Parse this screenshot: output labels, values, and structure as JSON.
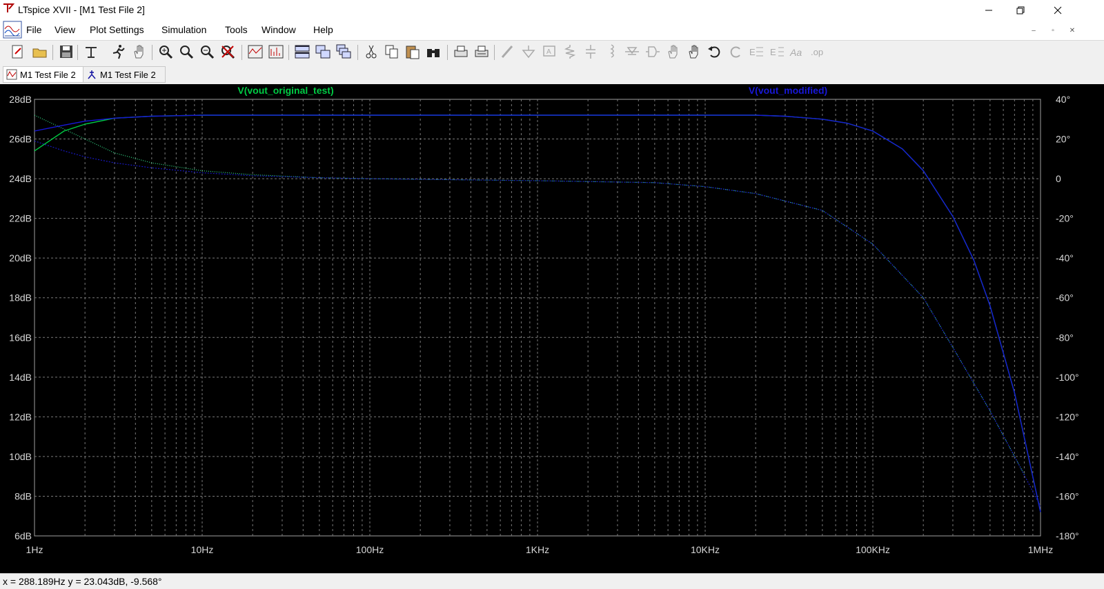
{
  "window": {
    "title": "LTspice XVII - [M1 Test File 2]"
  },
  "menu": {
    "items": [
      "File",
      "View",
      "Plot Settings",
      "Simulation",
      "Tools",
      "Window",
      "Help"
    ]
  },
  "toolbar": {
    "icons": [
      "new-schematic",
      "open",
      "save",
      "control-panel",
      "run",
      "halt",
      "zoom-area",
      "zoom-in",
      "zoom-out",
      "zoom-cancel",
      "autorange",
      "fft",
      "tile-horizontal",
      "tile-vertical",
      "cascade",
      "cut",
      "copy",
      "paste",
      "find",
      "print",
      "print-setup",
      "draw-wire",
      "ground",
      "label-net",
      "resistor",
      "capacitor",
      "inductor",
      "diode",
      "component",
      "move",
      "drag",
      "undo",
      "redo",
      "rotate",
      "mirror",
      "text",
      "spice-directive"
    ]
  },
  "tabs": [
    {
      "label": "M1 Test File 2",
      "active": true,
      "kind": "waveform"
    },
    {
      "label": "M1 Test File 2",
      "active": false,
      "kind": "schematic"
    }
  ],
  "status": {
    "text": "x = 288.189Hz   y = 23.043dB, -9.568°"
  },
  "chart_data": {
    "type": "line",
    "x_scale": "log",
    "xlim": [
      1,
      1000000
    ],
    "x_ticks": [
      "1Hz",
      "10Hz",
      "100Hz",
      "1KHz",
      "10KHz",
      "100KHz",
      "1MHz"
    ],
    "y_left_ticks": [
      "28dB",
      "26dB",
      "24dB",
      "22dB",
      "20dB",
      "18dB",
      "16dB",
      "14dB",
      "12dB",
      "10dB",
      "8dB",
      "6dB"
    ],
    "ylim_left": [
      6,
      28
    ],
    "y_right_ticks": [
      "40°",
      "20°",
      "0",
      "-20°",
      "-40°",
      "-60°",
      "-80°",
      "-100°",
      "-120°",
      "-140°",
      "-160°",
      "-180°"
    ],
    "ylim_right": [
      -180,
      40
    ],
    "grid": true,
    "series": [
      {
        "name": "V(vout_original_test)",
        "color": "#00cc44",
        "phase_color": "#33dd88",
        "mag": [
          [
            1,
            25.4
          ],
          [
            1.5,
            26.4
          ],
          [
            2,
            26.75
          ],
          [
            3,
            27.05
          ],
          [
            5,
            27.15
          ],
          [
            10,
            27.2
          ],
          [
            100,
            27.2
          ],
          [
            1000,
            27.2
          ],
          [
            10000,
            27.2
          ],
          [
            20000,
            27.2
          ],
          [
            30000,
            27.15
          ],
          [
            50000,
            27.0
          ],
          [
            70000,
            26.8
          ],
          [
            100000,
            26.4
          ],
          [
            150000,
            25.5
          ],
          [
            200000,
            24.4
          ],
          [
            300000,
            22.1
          ],
          [
            400000,
            19.9
          ],
          [
            500000,
            17.6
          ],
          [
            700000,
            13.2
          ],
          [
            1000000,
            7.2
          ]
        ],
        "phase": [
          [
            1,
            32
          ],
          [
            1.5,
            25
          ],
          [
            2,
            20
          ],
          [
            3,
            13
          ],
          [
            5,
            8
          ],
          [
            10,
            4
          ],
          [
            20,
            2
          ],
          [
            50,
            0.5
          ],
          [
            100,
            0
          ],
          [
            300,
            -0.5
          ],
          [
            1000,
            -1
          ],
          [
            5000,
            -2
          ],
          [
            10000,
            -4
          ],
          [
            20000,
            -7.5
          ],
          [
            50000,
            -16
          ],
          [
            100000,
            -33
          ],
          [
            200000,
            -60
          ],
          [
            300000,
            -85
          ],
          [
            500000,
            -117
          ],
          [
            700000,
            -140
          ],
          [
            800000,
            -149
          ]
        ]
      },
      {
        "name": "V(vout_modified)",
        "color": "#1818d8",
        "phase_color": "#1818c0",
        "mag": [
          [
            1,
            26.4
          ],
          [
            1.5,
            26.7
          ],
          [
            2,
            26.9
          ],
          [
            3,
            27.05
          ],
          [
            5,
            27.15
          ],
          [
            10,
            27.2
          ],
          [
            100,
            27.2
          ],
          [
            1000,
            27.2
          ],
          [
            10000,
            27.2
          ],
          [
            20000,
            27.2
          ],
          [
            30000,
            27.15
          ],
          [
            50000,
            27.0
          ],
          [
            70000,
            26.8
          ],
          [
            100000,
            26.4
          ],
          [
            150000,
            25.5
          ],
          [
            200000,
            24.4
          ],
          [
            300000,
            22.1
          ],
          [
            400000,
            19.9
          ],
          [
            500000,
            17.6
          ],
          [
            700000,
            13.2
          ],
          [
            1000000,
            7.2
          ]
        ],
        "phase": [
          [
            1,
            19
          ],
          [
            1.5,
            14
          ],
          [
            2,
            11
          ],
          [
            3,
            8
          ],
          [
            5,
            5.5
          ],
          [
            10,
            3
          ],
          [
            20,
            1.5
          ],
          [
            50,
            0.5
          ],
          [
            100,
            0
          ],
          [
            300,
            -0.5
          ],
          [
            1000,
            -1
          ],
          [
            5000,
            -2
          ],
          [
            10000,
            -4
          ],
          [
            20000,
            -7.5
          ],
          [
            50000,
            -16
          ],
          [
            100000,
            -33
          ],
          [
            200000,
            -60
          ],
          [
            300000,
            -85
          ],
          [
            500000,
            -117
          ],
          [
            700000,
            -140
          ],
          [
            1000000,
            -165
          ]
        ]
      }
    ]
  }
}
